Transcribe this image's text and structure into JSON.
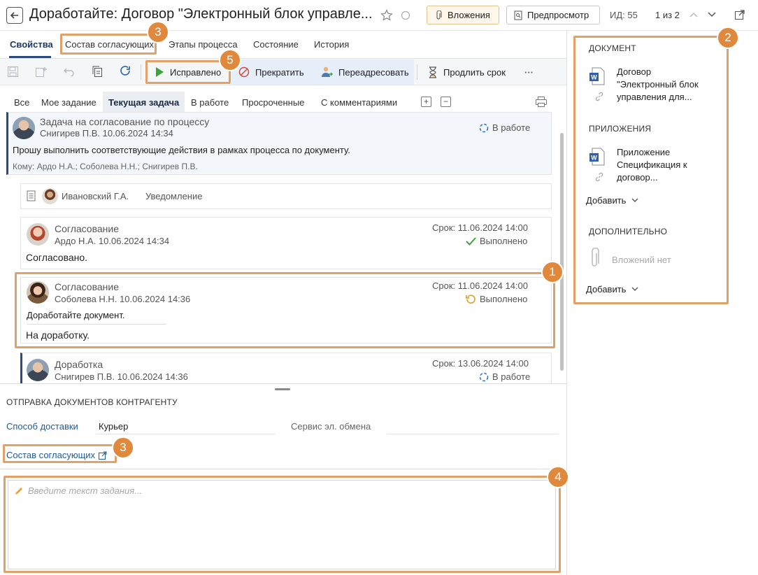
{
  "header": {
    "title": "Доработайте: Договор \"Электронный блок управле...",
    "attachments_label": "Вложения",
    "preview_label": "Предпросмотр",
    "id_text": "ИД: 55",
    "pager_text": "1 из 2"
  },
  "tabs": [
    "Свойства",
    "Состав согласующих",
    "Этапы процесса",
    "Состояние",
    "История"
  ],
  "toolbar": {
    "fixed_label": "Исправлено",
    "stop_label": "Прекратить",
    "forward_label": "Переадресовать",
    "extend_label": "Продлить срок",
    "more_label": "···"
  },
  "filters": [
    "Все",
    "Мое задание",
    "Текущая задача",
    "В работе",
    "Просроченные",
    "С комментариями"
  ],
  "feed": {
    "task": {
      "title": "Задача на согласование по процессу",
      "author_date": "Снигирев П.В.   10.06.2024 14:34",
      "status": "В работе",
      "text": "Прошу выполнить соответствующие действия в рамках процесса по документу.",
      "recipients": "Кому: Ардо Н.А.; Соболева Н.Н.; Снигирев П.В."
    },
    "notice": {
      "author": "Ивановский Г.А.",
      "type": "Уведомление"
    },
    "approval1": {
      "title": "Согласование",
      "author_date": "Ардо Н.А.   10.06.2024 14:34",
      "due": "Срок: 11.06.2024 14:00",
      "status": "Выполнено",
      "text": "Согласовано."
    },
    "approval2": {
      "title": "Согласование",
      "author_date": "Соболева Н.Н.   10.06.2024 14:36",
      "due": "Срок: 11.06.2024 14:00",
      "status": "Выполнено",
      "quote": "Доработайте документ.",
      "text": "На доработку."
    },
    "rework": {
      "title": "Доработка",
      "author_date": "Снигирев П.В.   10.06.2024 14:36",
      "due": "Срок: 13.06.2024 14:00",
      "status": "В работе"
    }
  },
  "counterparty": {
    "section_title": "ОТПРАВКА ДОКУМЕНТОВ КОНТРАГЕНТУ",
    "delivery_label": "Способ доставки",
    "delivery_value": "Курьер",
    "service_label": "Сервис эл. обмена",
    "approvers_link": "Состав согласующих"
  },
  "task_input": {
    "placeholder": "Введите текст задания..."
  },
  "right_panel": {
    "document_head": "ДОКУМЕНТ",
    "document_name": [
      "Договор",
      "\"Электронный блок",
      "управления для..."
    ],
    "attachments_head": "ПРИЛОЖЕНИЯ",
    "attachment_name": [
      "Приложение",
      "Спецификация к",
      "договор..."
    ],
    "add_label": "Добавить",
    "extra_head": "ДОПОЛНИТЕЛЬНО",
    "no_attachments": "Вложений нет"
  },
  "callouts": [
    "1",
    "2",
    "3",
    "3",
    "4",
    "5"
  ],
  "colors": {
    "callout": "#e0893c",
    "callout_border": "#e0a268",
    "accent": "#2b4b7e",
    "link": "#1f5a99"
  }
}
